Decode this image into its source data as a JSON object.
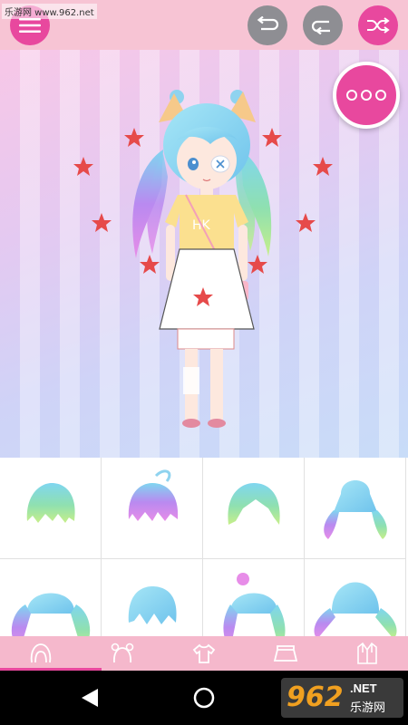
{
  "watermark": {
    "text": "乐游网 www.962.net"
  },
  "toolbar": {
    "menu_icon": "hamburger-icon",
    "redo_icon": "redo-icon",
    "undo_icon": "undo-icon",
    "shuffle_icon": "shuffle-icon"
  },
  "stage": {
    "more_icon": "three-dots-icon",
    "shirt_text": "HK"
  },
  "categories": [
    {
      "icon": "hair-front-icon",
      "selected": true
    },
    {
      "icon": "hair-buns-icon",
      "selected": false
    },
    {
      "icon": "shirt-icon",
      "selected": false
    },
    {
      "icon": "skirt-icon",
      "selected": false
    },
    {
      "icon": "jacket-icon",
      "selected": false
    }
  ],
  "nav": {
    "back_icon": "back-triangle-icon",
    "home_icon": "home-circle-icon"
  },
  "brand_logo": {
    "number": "962",
    "suffix": ".NET",
    "name": "乐游网"
  },
  "colors": {
    "accent": "#e8489e",
    "topbar": "#f7c4d4",
    "tabbar": "#f5b8cc",
    "grey_button": "#8e8e93"
  }
}
